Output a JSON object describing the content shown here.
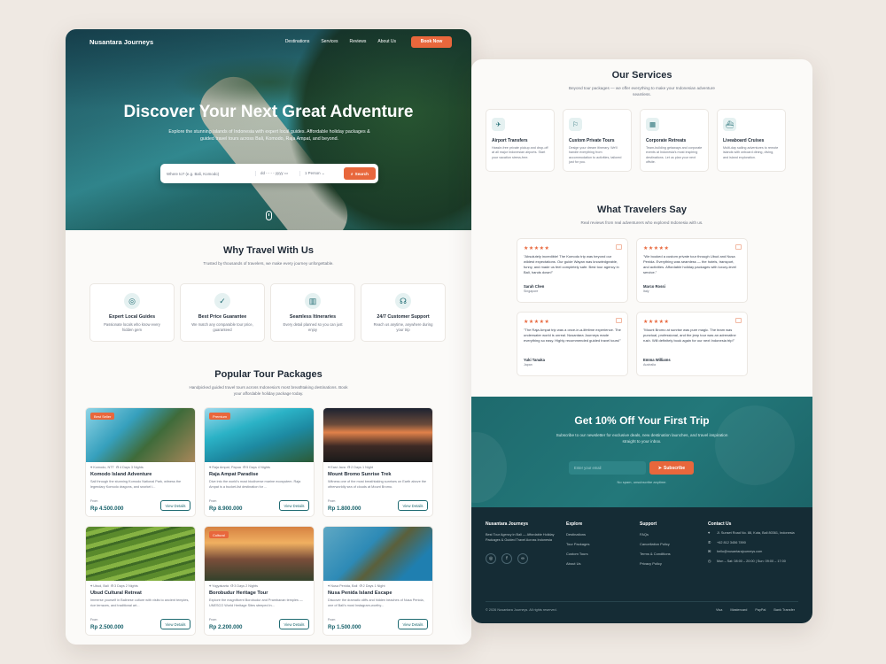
{
  "nav": {
    "brand": "Nusantara Journeys",
    "links": [
      "Destinations",
      "Services",
      "Reviews",
      "About Us"
    ],
    "cta": "Book Now"
  },
  "hero": {
    "title": "Discover Your Next Great Adventure",
    "subtitle": "Explore the stunning islands of Indonesia with expert local guides. Affordable holiday packages & guided travel tours across Bali, Komodo, Raja Ampat, and beyond.",
    "search": {
      "location_placeholder": "Where to? (e.g. Bali, Komodo)",
      "date_placeholder": "dd - - - - yyyy",
      "people_value": "1 Person",
      "button": "Search"
    }
  },
  "why": {
    "title": "Why Travel With Us",
    "subtitle": "Trusted by thousands of travelers, we make every journey unforgettable.",
    "features": [
      {
        "icon": "compass-icon",
        "glyph": "◎",
        "title": "Expert Local Guides",
        "desc": "Passionate locals who know every hidden gem"
      },
      {
        "icon": "check-shield-icon",
        "glyph": "✓",
        "title": "Best Price Guarantee",
        "desc": "We match any comparable tour price, guaranteed"
      },
      {
        "icon": "map-icon",
        "glyph": "▥",
        "title": "Seamless Itineraries",
        "desc": "Every detail planned so you can just enjoy"
      },
      {
        "icon": "headset-icon",
        "glyph": "☊",
        "title": "24/7 Customer Support",
        "desc": "Reach us anytime, anywhere during your trip"
      }
    ]
  },
  "tours": {
    "title": "Popular Tour Packages",
    "subtitle": "Handpicked guided travel tours across Indonesia's most breathtaking destinations. Book your affordable holiday package today.",
    "from_label": "From",
    "view_label": "View Details",
    "items": [
      {
        "tag": "Best Seller",
        "location": "Komodo, NTT",
        "duration": "4 Days 3 Nights",
        "name": "Komodo Island Adventure",
        "desc": "Sail through the stunning Komodo National Park, witness the legendary Komodo dragons, and snorkel i...",
        "price": "Rp 4.500.000",
        "img": "i1"
      },
      {
        "tag": "Premium",
        "location": "Raja Ampat, Papua",
        "duration": "5 Days 4 Nights",
        "name": "Raja Ampat Paradise",
        "desc": "Dive into the world's most biodiverse marine ecosystem. Raja Ampat is a bucket-list destination for ...",
        "price": "Rp 8.900.000",
        "img": "i2"
      },
      {
        "tag": "",
        "location": "East Java",
        "duration": "2 Days 1 Night",
        "name": "Mount Bromo Sunrise Trek",
        "desc": "Witness one of the most breathtaking sunrises on Earth above the otherworldly sea of clouds at Mount Bromo.",
        "price": "Rp 1.800.000",
        "img": "i3"
      },
      {
        "tag": "",
        "location": "Ubud, Bali",
        "duration": "3 Days 2 Nights",
        "name": "Ubud Cultural Retreat",
        "desc": "Immerse yourself in Balinese culture with visits to ancient temples, rice terraces, and traditional art...",
        "price": "Rp 2.500.000",
        "img": "i4"
      },
      {
        "tag": "Cultural",
        "location": "Yogyakarta",
        "duration": "3 Days 2 Nights",
        "name": "Borobudur Heritage Tour",
        "desc": "Explore the magnificent Borobudur and Prambanan temples — UNESCO World Heritage Sites steeped in...",
        "price": "Rp 2.200.000",
        "img": "i5"
      },
      {
        "tag": "",
        "location": "Nusa Penida, Bali",
        "duration": "2 Days 1 Night",
        "name": "Nusa Penida Island Escape",
        "desc": "Discover the dramatic cliffs and hidden beaches of Nusa Penida, one of Bali's most Instagram-worthy...",
        "price": "Rp 1.500.000",
        "img": "i6"
      }
    ]
  },
  "services": {
    "title": "Our Services",
    "subtitle": "Beyond tour packages — we offer everything to make your Indonesian adventure seamless.",
    "items": [
      {
        "icon": "plane-icon",
        "glyph": "✈",
        "title": "Airport Transfers",
        "desc": "Hassle-free private pickup and drop-off at all major Indonesian airports. Start your vacation stress-free."
      },
      {
        "icon": "route-icon",
        "glyph": "⚐",
        "title": "Custom Private Tours",
        "desc": "Design your dream itinerary. We'll handle everything from accommodation to activities, tailored just for you."
      },
      {
        "icon": "building-icon",
        "glyph": "▦",
        "title": "Corporate Retreats",
        "desc": "Team-building getaways and corporate events at Indonesia's most inspiring destinations. Let us plan your next offsite."
      },
      {
        "icon": "ship-icon",
        "glyph": "⛴",
        "title": "Liveaboard Cruises",
        "desc": "Multi-day sailing adventures to remote islands with onboard dining, diving, and island exploration."
      }
    ]
  },
  "reviews": {
    "title": "What Travelers Say",
    "subtitle": "Real reviews from real adventurers who explored Indonesia with us.",
    "stars": "★★★★★",
    "items": [
      {
        "text": "\"Absolutely incredible! The Komodo trip was beyond our wildest expectations. Our guide Wayan was knowledgeable, funny, and made us feel completely safe. Best tour agency in Bali, hands down!\"",
        "name": "Sarah Chen",
        "country": "Singapore"
      },
      {
        "text": "\"We booked a custom private tour through Ubud and Nusa Penida. Everything was seamless — the hotels, transport, and activities. Affordable holiday packages with luxury-level service.\"",
        "name": "Marco Rossi",
        "country": "Italy"
      },
      {
        "text": "\"The Raja Ampat trip was a once-in-a-lifetime experience. The underwater world is unreal. Nusantara Journeys made everything so easy. Highly recommended guided travel tours!\"",
        "name": "Yuki Tanaka",
        "country": "Japan"
      },
      {
        "text": "\"Mount Bromo at sunrise was pure magic. The team was punctual, professional, and the jeep tour was an adrenaline rush. Will definitely book again for our next Indonesia trip!\"",
        "name": "Emma Williams",
        "country": "Australia"
      }
    ]
  },
  "promo": {
    "title": "Get 10% Off Your First Trip",
    "subtitle": "Subscribe to our newsletter for exclusive deals, new destination launches, and travel inspiration straight to your inbox.",
    "email_placeholder": "Enter your email",
    "button": "Subscribe",
    "note": "No spam, unsubscribe anytime."
  },
  "footer": {
    "brand": "Nusantara Journeys",
    "about": "Best Tour Agency in Bali — Affordable Holiday Packages & Guided Travel Across Indonesia",
    "social": [
      "instagram-icon",
      "facebook-icon",
      "tripadvisor-icon"
    ],
    "social_glyphs": [
      "◎",
      "f",
      "∞"
    ],
    "explore_title": "Explore",
    "explore": [
      "Destinations",
      "Tour Packages",
      "Custom Tours",
      "About Us"
    ],
    "support_title": "Support",
    "support": [
      "FAQs",
      "Cancellation Policy",
      "Terms & Conditions",
      "Privacy Policy"
    ],
    "contact_title": "Contact Us",
    "contact": [
      {
        "icon": "pin-icon",
        "glyph": "⌖",
        "text": "Jl. Sunset Road No. 88, Kuta, Bali 80361, Indonesia"
      },
      {
        "icon": "phone-icon",
        "glyph": "✆",
        "text": "+62 812 3456 7890"
      },
      {
        "icon": "mail-icon",
        "glyph": "✉",
        "text": "hello@nusantarajourneys.com"
      },
      {
        "icon": "clock-icon",
        "glyph": "◷",
        "text": "Mon – Sat: 08:00 – 20:00 | Sun: 09:00 – 17:00"
      }
    ],
    "copyright": "© 2026 Nusantara Journeys. All rights reserved.",
    "payments": [
      "Visa",
      "Mastercard",
      "PayPal",
      "Bank Transfer"
    ]
  },
  "colors": {
    "accent": "#e8673c",
    "primary": "#1f6b72",
    "footer": "#152c35"
  }
}
